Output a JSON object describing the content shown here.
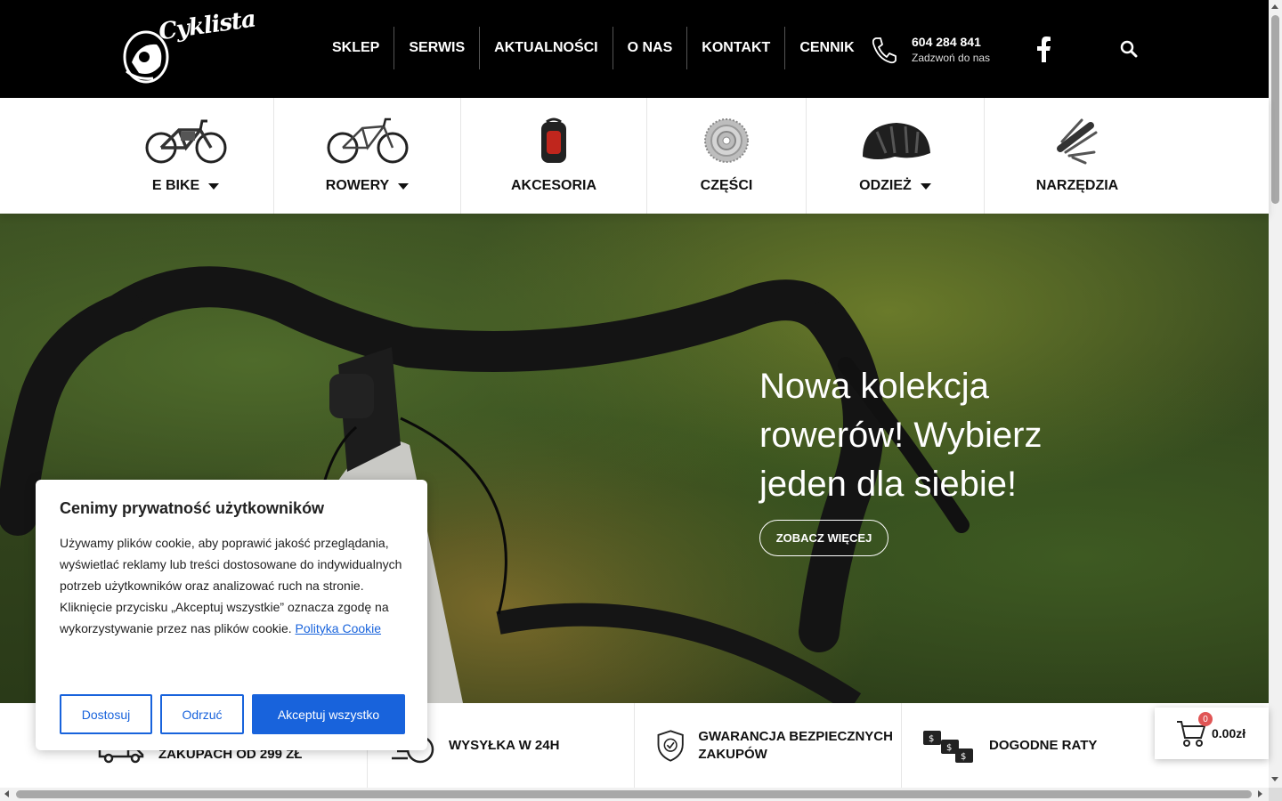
{
  "header": {
    "logo_text": "Cyklista",
    "nav": [
      "SKLEP",
      "SERWIS",
      "AKTUALNOŚCI",
      "O NAS",
      "KONTAKT",
      "CENNIK"
    ],
    "phone_number": "604 284 841",
    "phone_caption": "Zadzwoń do nas",
    "icons": [
      "phone-icon",
      "facebook-icon",
      "search-icon"
    ]
  },
  "categories": [
    {
      "label": "E BIKE",
      "dropdown": true,
      "icon": "ebike-image"
    },
    {
      "label": "ROWERY",
      "dropdown": true,
      "icon": "bike-image"
    },
    {
      "label": "AKCESORIA",
      "dropdown": false,
      "icon": "backpack-image"
    },
    {
      "label": "CZĘŚCI",
      "dropdown": false,
      "icon": "cassette-image"
    },
    {
      "label": "ODZIEŻ",
      "dropdown": true,
      "icon": "helmet-image"
    },
    {
      "label": "NARZĘDZIA",
      "dropdown": false,
      "icon": "multitool-image"
    }
  ],
  "hero": {
    "title": "Nowa kolekcja rowerów! Wybierz jeden dla siebie!",
    "button": "ZOBACZ WIĘCEJ"
  },
  "features": [
    {
      "text": "ZAKUPACH OD 299 ZŁ",
      "icon": "delivery-truck-icon"
    },
    {
      "text": "WYSYŁKA W 24H",
      "icon": "fast-shipping-icon"
    },
    {
      "text": "GWARANCJA BEZPIECZNYCH ZAKUPÓW",
      "icon": "shield-check-icon"
    },
    {
      "text": "DOGODNE RATY",
      "icon": "installments-icon"
    }
  ],
  "cart": {
    "count": "0",
    "total": "0.00zł"
  },
  "cookie": {
    "title": "Cenimy prywatność użytkowników",
    "body": "Używamy plików cookie, aby poprawić jakość przeglądania, wyświetlać reklamy lub treści dostosowane do indywidualnych potrzeb użytkowników oraz analizować ruch na stronie. Kliknięcie przycisku „Akceptuj wszystkie” oznacza zgodę na wykorzystywanie przez nas plików cookie.",
    "link": "Polityka Cookie",
    "buttons": {
      "customize": "Dostosuj",
      "reject": "Odrzuć",
      "accept": "Akceptuj wszystko"
    }
  },
  "colors": {
    "accent": "#1863dc",
    "header_bg": "#000000",
    "badge": "#e05555"
  }
}
